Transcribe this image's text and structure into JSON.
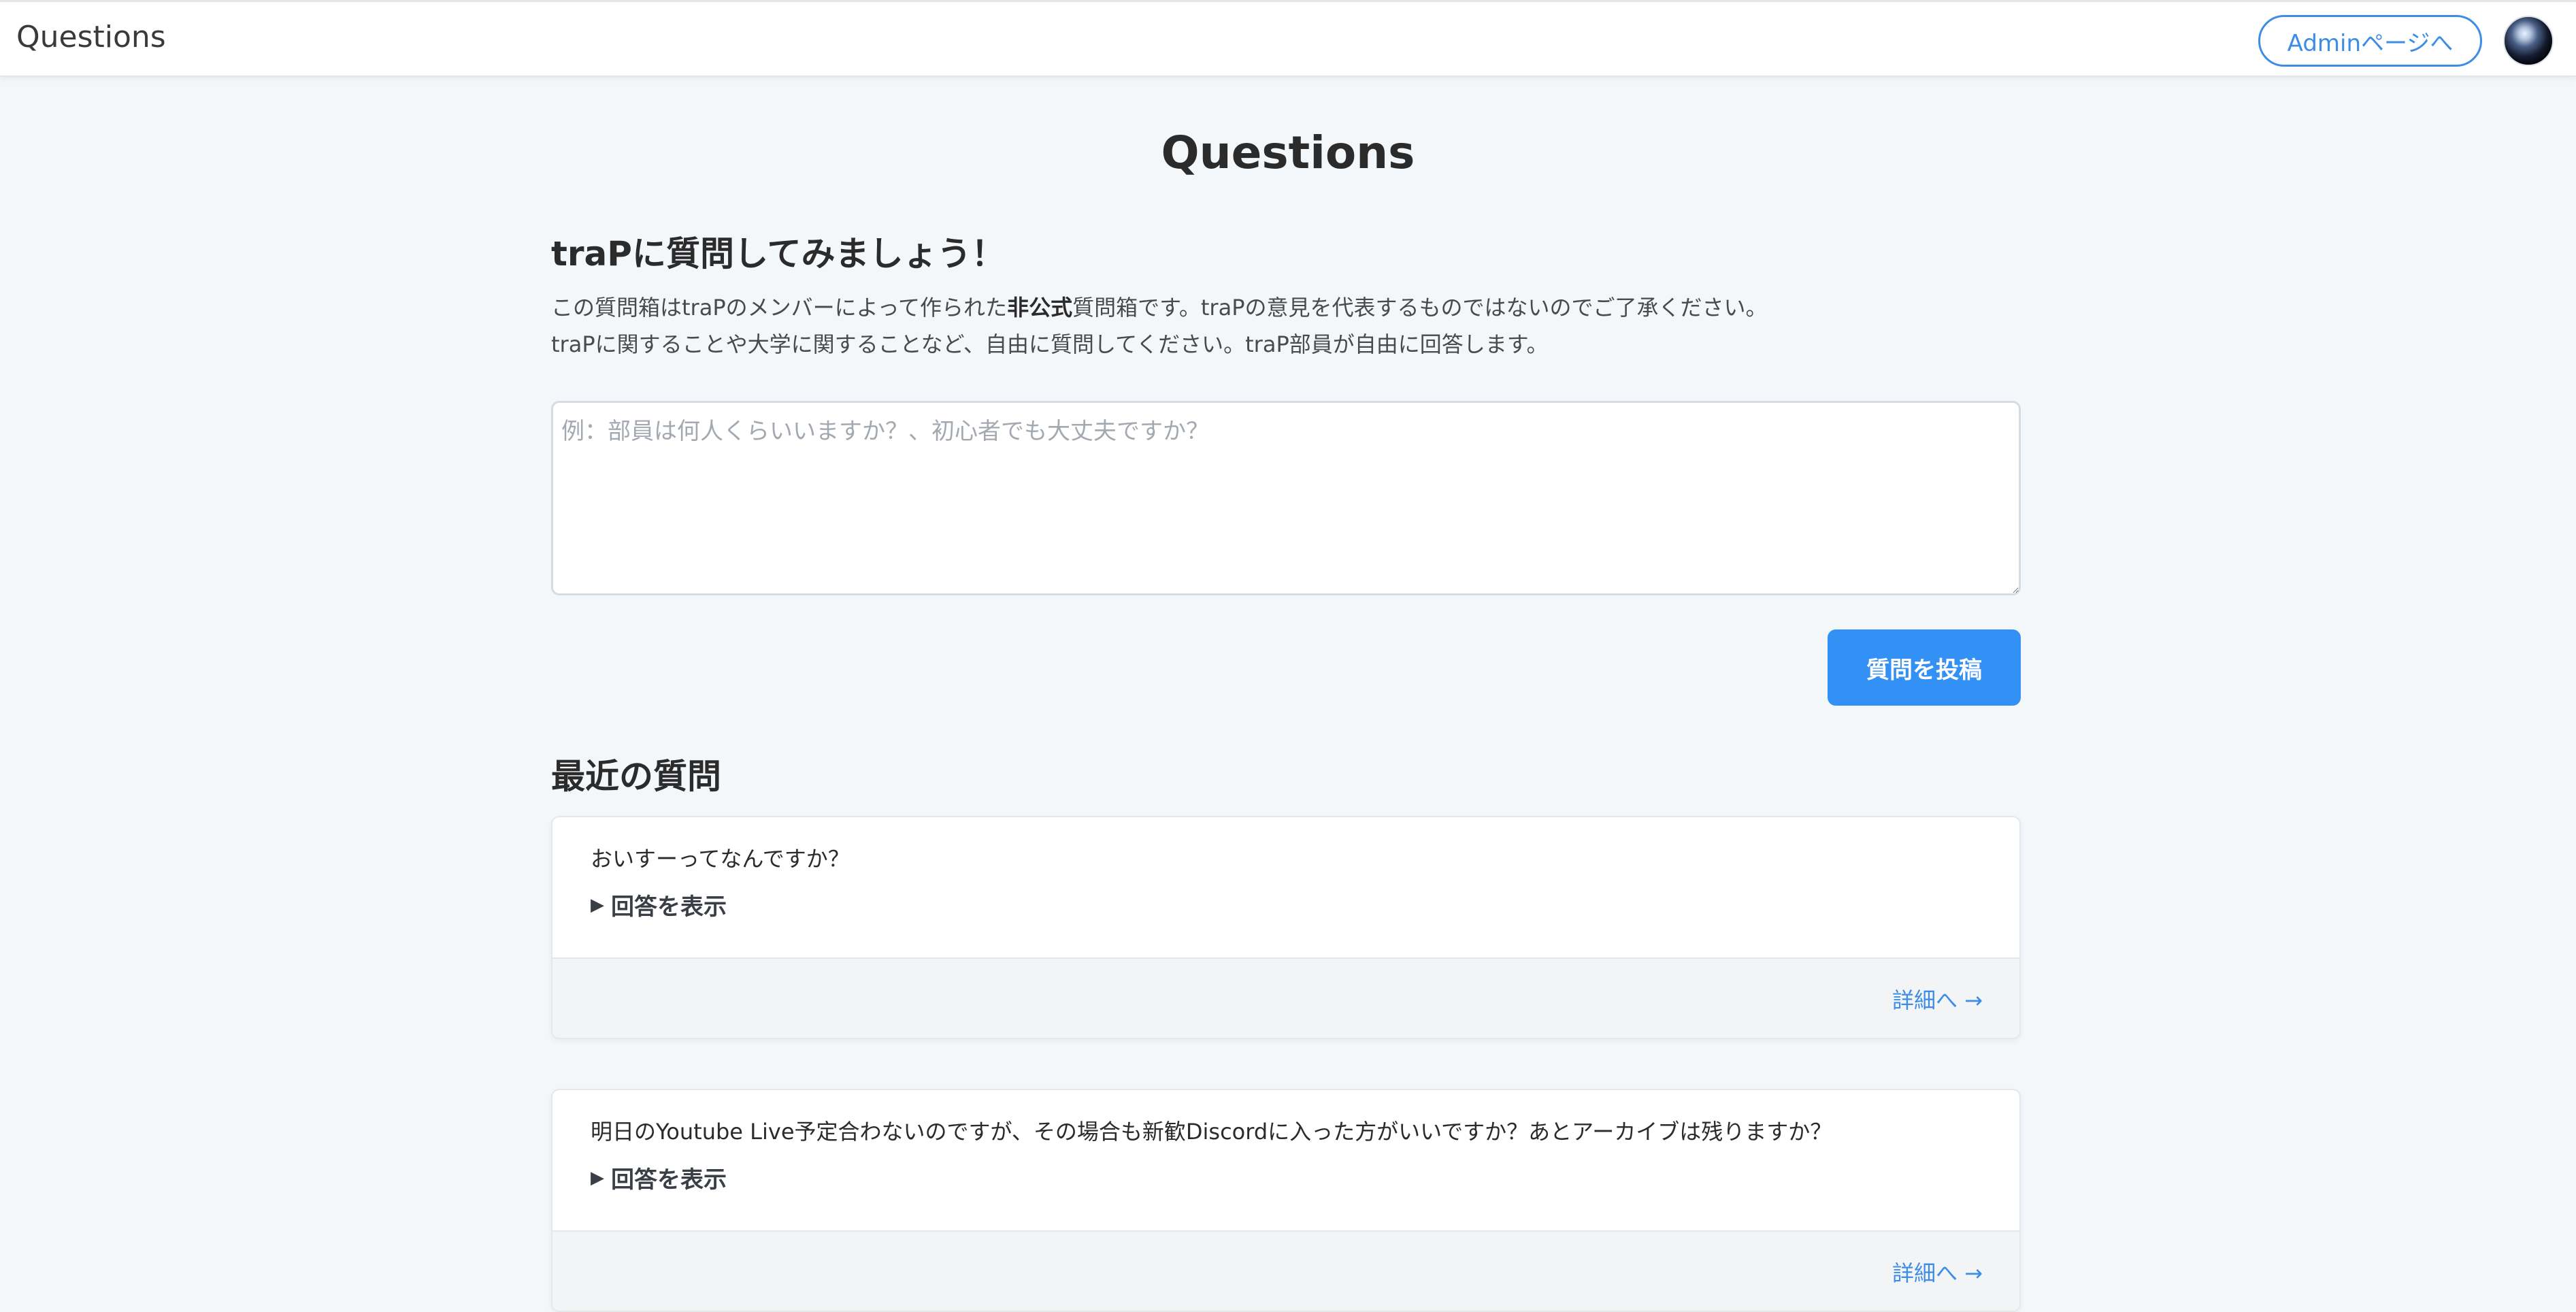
{
  "header": {
    "brand": "Questions",
    "admin_button": "Adminページへ"
  },
  "main": {
    "title": "Questions",
    "ask_heading": "traPに質問してみましょう！",
    "intro_line1_pre": "この質問箱はtraPのメンバーによって作られた",
    "intro_line1_bold": "非公式",
    "intro_line1_post": "質問箱です。traPの意見を代表するものではないのでご了承ください。",
    "intro_line2": "traPに関することや大学に関することなど、自由に質問してください。traP部員が自由に回答します。",
    "question_placeholder": "例：部員は何人くらいいますか？、初心者でも大丈夫ですか？",
    "question_value": "",
    "submit_label": "質問を投稿",
    "recent_heading": "最近の質問"
  },
  "questions": [
    {
      "text": "おいすーってなんですか？",
      "toggle_label": "回答を表示",
      "detail_link": "詳細へ →"
    },
    {
      "text": "明日のYoutube Live予定合わないのですが、その場合も新歓Discordに入った方がいいですか？あとアーカイブは残りますか？",
      "toggle_label": "回答を表示",
      "detail_link": "詳細へ →"
    }
  ],
  "icons": {
    "toggle": "triangle-right-icon",
    "avatar": "user-avatar"
  },
  "colors": {
    "accent": "#3390f5",
    "link": "#3d8ce6",
    "background": "#f4f7fa"
  }
}
